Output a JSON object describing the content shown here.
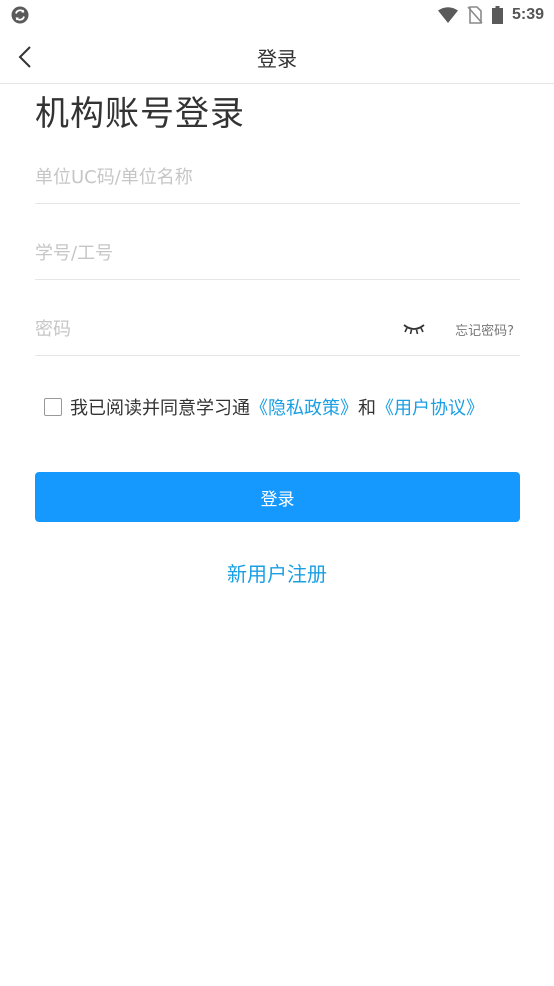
{
  "status_bar": {
    "time": "5:39",
    "icons": [
      "app-sync-icon",
      "wifi-icon",
      "no-sim-icon",
      "battery-icon"
    ]
  },
  "nav": {
    "back_icon": "chevron-left-icon",
    "title": "登录"
  },
  "page": {
    "heading": "机构账号登录"
  },
  "form": {
    "org_field": {
      "placeholder": "单位UC码/单位名称",
      "value": ""
    },
    "id_field": {
      "placeholder": "学号/工号",
      "value": ""
    },
    "password_field": {
      "placeholder": "密码",
      "value": ""
    },
    "eye_icon": "eye-closed-icon",
    "forgot_label": "忘记密码?"
  },
  "agreement": {
    "checked": false,
    "text": "我已阅读并同意学习通",
    "privacy_link": "《隐私政策》",
    "conjunction": "和",
    "user_link": "《用户协议》"
  },
  "login_button": {
    "label": "登录"
  },
  "register_link": {
    "label": "新用户注册"
  },
  "colors": {
    "accent": "#1599ff",
    "link": "#1a9fe3",
    "placeholder": "#c6c6c6",
    "divider": "#e6e6e6"
  }
}
